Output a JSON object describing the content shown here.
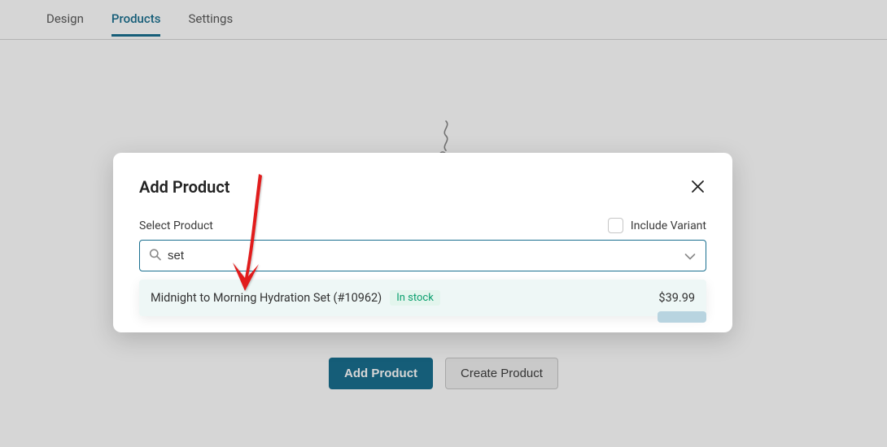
{
  "tabs": {
    "design": "Design",
    "products": "Products",
    "settings": "Settings"
  },
  "cta": {
    "add": "Add Product",
    "create": "Create Product"
  },
  "modal": {
    "title": "Add Product",
    "select_label": "Select Product",
    "include_variant": "Include Variant",
    "search_value": "set",
    "option": {
      "name": "Midnight to Morning Hydration Set (#10962)",
      "stock": "In stock",
      "price": "$39.99"
    }
  }
}
